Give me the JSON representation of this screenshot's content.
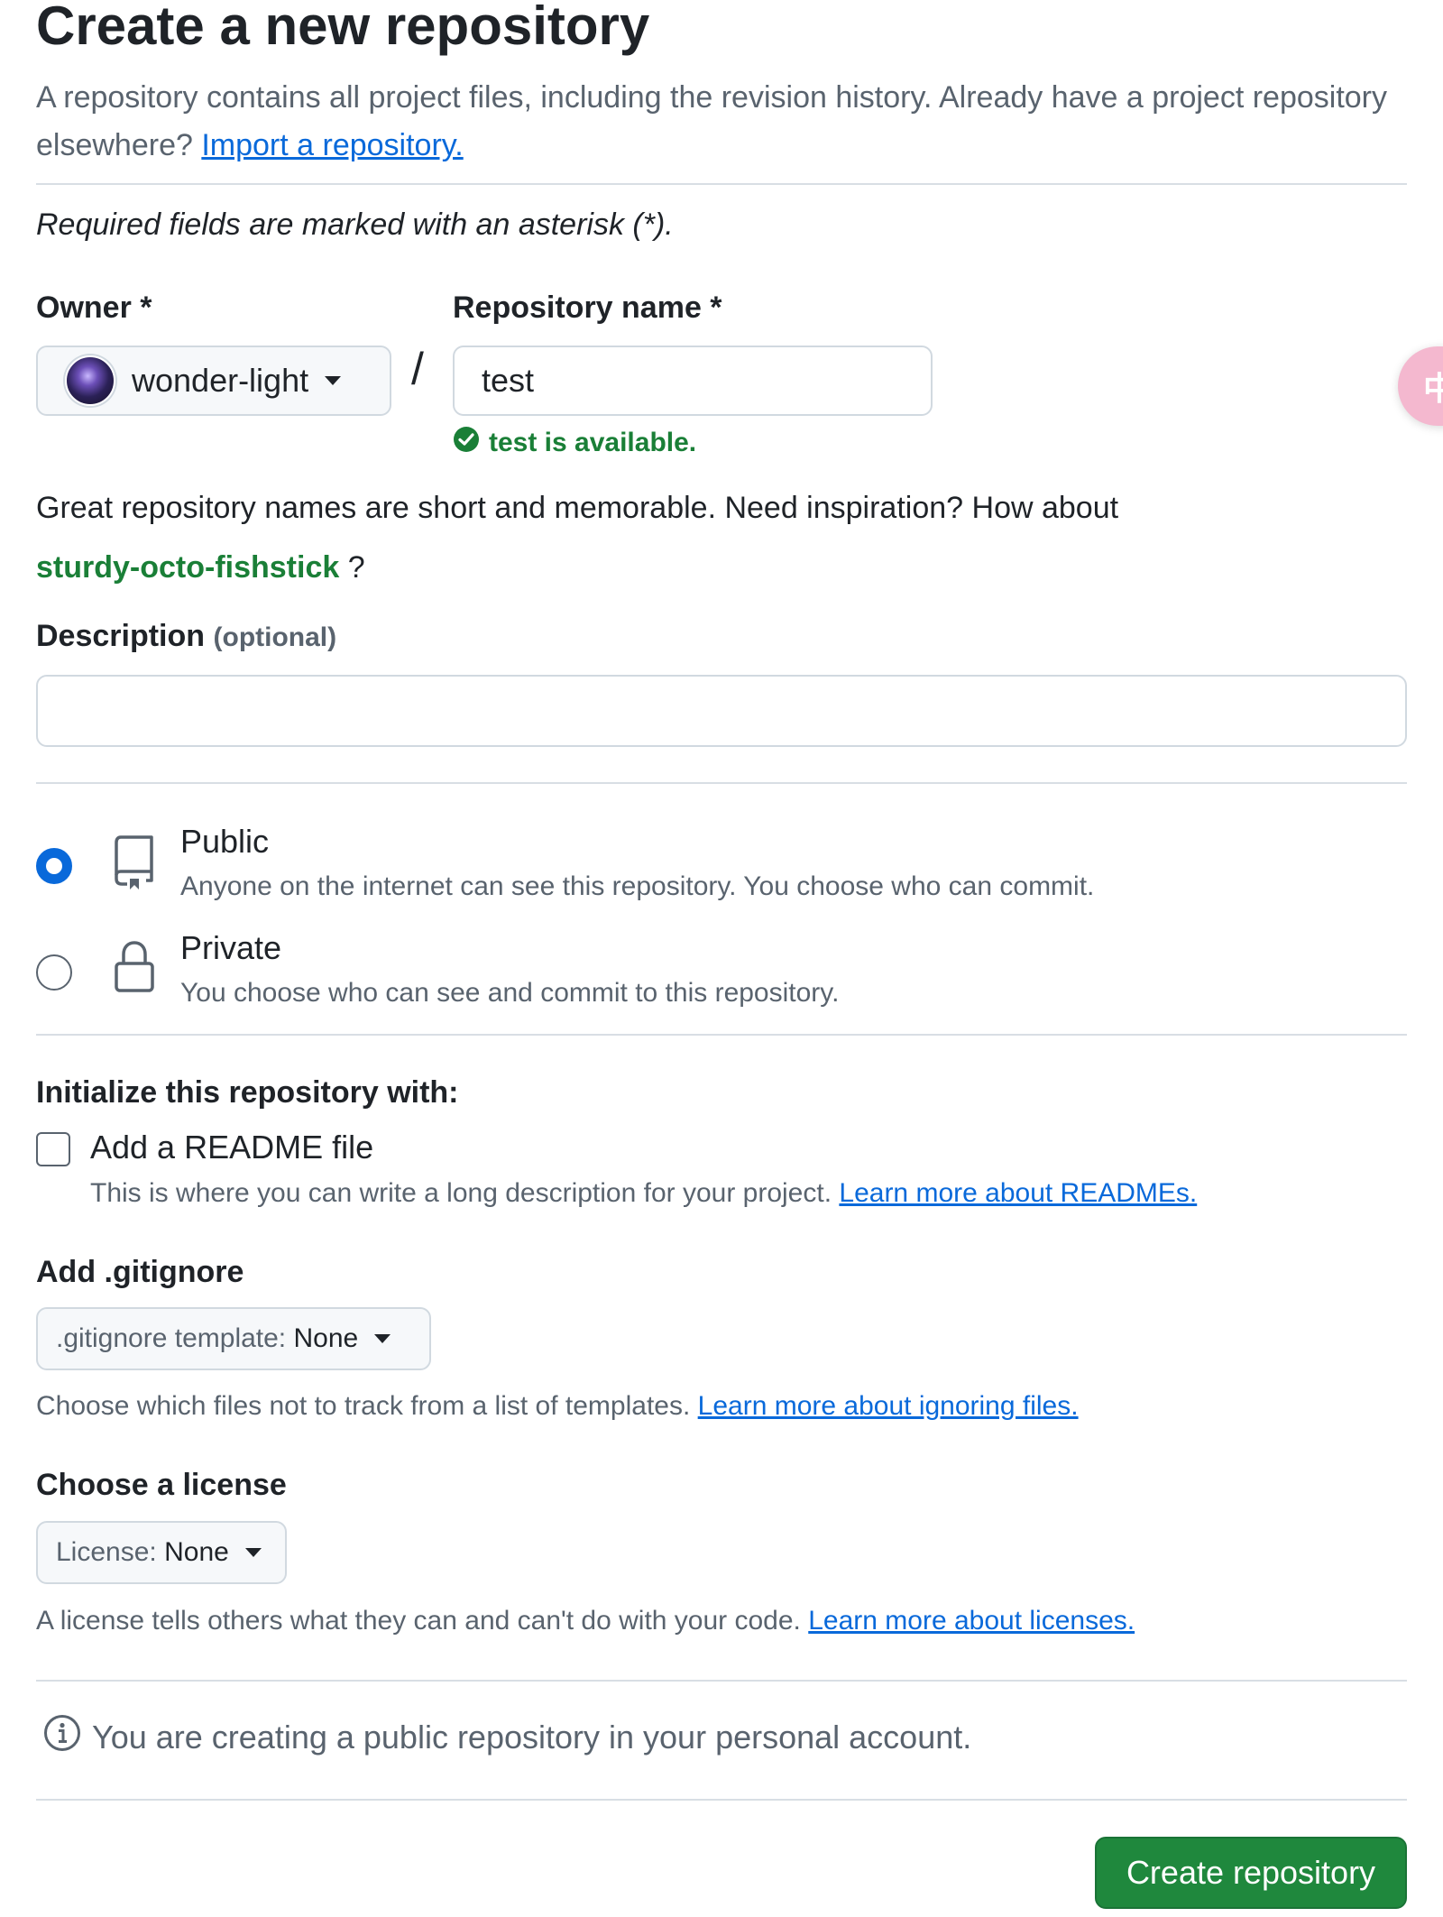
{
  "header": {
    "title": "Create a new repository",
    "subtitle": "A repository contains all project files, including the revision history. Already have a project repository elsewhere?",
    "import_link": "Import a repository."
  },
  "required_note": "Required fields are marked with an asterisk (*).",
  "owner": {
    "label": "Owner *",
    "value": "wonder-light"
  },
  "repo_name": {
    "label": "Repository name *",
    "value": "test",
    "availability": "test is available."
  },
  "inspiration": {
    "text": "Great repository names are short and memorable. Need inspiration? How about",
    "suggestion": "sturdy-octo-fishstick",
    "suffix": "?"
  },
  "description": {
    "label": "Description",
    "optional": "(optional)",
    "value": ""
  },
  "visibility": {
    "selected": "Public",
    "options": [
      {
        "title": "Public",
        "desc": "Anyone on the internet can see this repository. You choose who can commit."
      },
      {
        "title": "Private",
        "desc": "You choose who can see and commit to this repository."
      }
    ]
  },
  "initialize": {
    "heading": "Initialize this repository with:",
    "readme_label": "Add a README file",
    "readme_checked": false,
    "readme_help": "This is where you can write a long description for your project.",
    "readme_link": "Learn more about READMEs."
  },
  "gitignore": {
    "heading": "Add .gitignore",
    "select_prefix": ".gitignore template:",
    "select_value": "None",
    "help": "Choose which files not to track from a list of templates.",
    "link": "Learn more about ignoring files."
  },
  "license": {
    "heading": "Choose a license",
    "select_prefix": "License:",
    "select_value": "None",
    "help": "A license tells others what they can and can't do with your code.",
    "link": "Learn more about licenses."
  },
  "notice": "You are creating a public repository in your personal account.",
  "create_button": "Create repository",
  "translate_fab": {
    "icon": "translate-icon",
    "glyph": "中A"
  },
  "colors": {
    "accent_blue": "#0969da",
    "success_green": "#1a7f37",
    "primary_button": "#1f883d",
    "muted_text": "#59636e",
    "border": "#d1d9e0"
  }
}
